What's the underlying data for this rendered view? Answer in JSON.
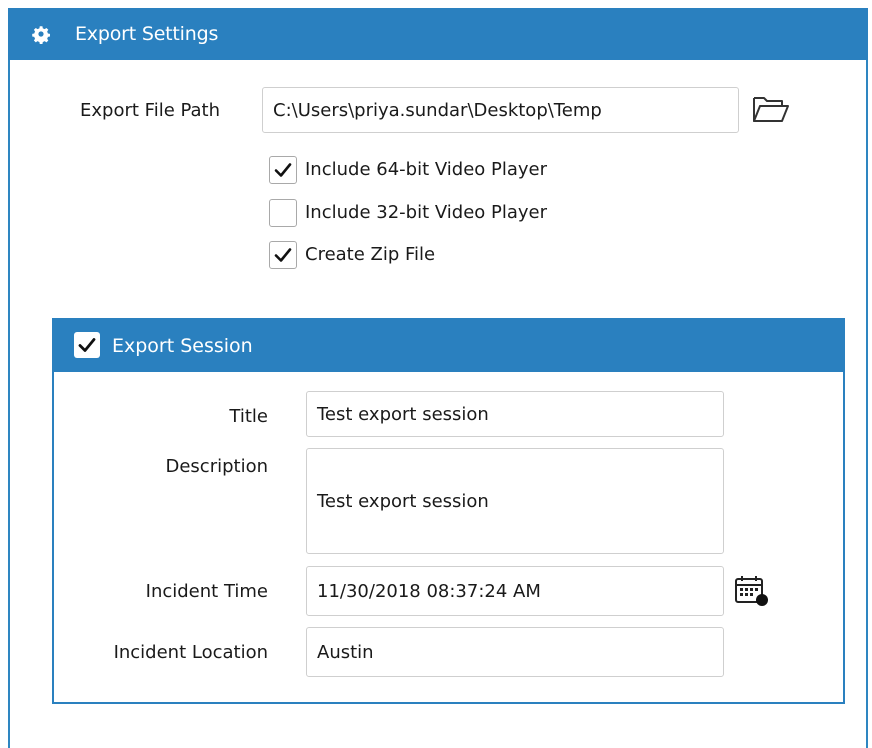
{
  "panel": {
    "title": "Export Settings",
    "icon": "gear-icon",
    "accent_color": "#2a80bf"
  },
  "export": {
    "file_path_label": "Export File Path",
    "file_path_value": "C:\\Users\\priya.sundar\\Desktop\\Temp",
    "browse_icon": "folder-open-icon",
    "options": [
      {
        "label": "Include 64-bit Video Player",
        "checked": true
      },
      {
        "label": "Include 32-bit Video Player",
        "checked": false
      },
      {
        "label": "Create Zip File",
        "checked": true
      }
    ]
  },
  "session": {
    "header_label": "Export Session",
    "enabled": true,
    "title_label": "Title",
    "title_value": "Test export session",
    "description_label": "Description",
    "description_value": "Test export session",
    "incident_time_label": "Incident Time",
    "incident_time_value": "11/30/2018 08:37:24 AM",
    "calendar_icon": "calendar-clock-icon",
    "incident_location_label": "Incident Location",
    "incident_location_value": "Austin"
  }
}
